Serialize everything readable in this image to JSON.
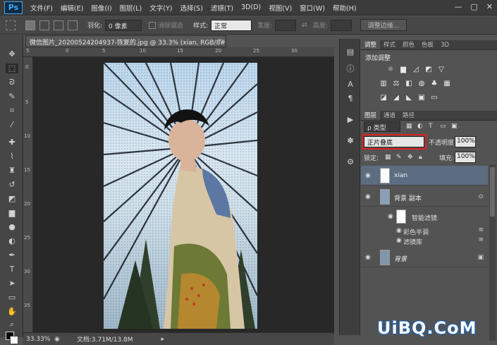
{
  "app": {
    "logo": "Ps"
  },
  "menu": [
    "文件(F)",
    "编辑(E)",
    "图像(I)",
    "图层(L)",
    "文字(Y)",
    "选择(S)",
    "滤镜(T)",
    "3D(D)",
    "视图(V)",
    "窗口(W)",
    "帮助(H)"
  ],
  "window_controls": {
    "minimize": "—",
    "restore": "▢",
    "close": "✕"
  },
  "options": {
    "feather_label": "羽化:",
    "feather_value": "0 像素",
    "antialias_label": "消除锯齿",
    "style_label": "样式:",
    "style_value": "正常",
    "width_label": "宽度:",
    "height_label": "高度:",
    "refine_edge": "调整边缘..."
  },
  "document": {
    "tab_title": "微信图片_20200524204937-恢复的.jpg @ 33.3% (xian, RGB/8#) *",
    "close": "×"
  },
  "ruler": {
    "top_ticks": [
      "5",
      "0",
      "5",
      "10",
      "15",
      "20",
      "25",
      "30"
    ],
    "left_ticks": [
      "0",
      "5",
      "10",
      "15",
      "20",
      "25",
      "30",
      "35"
    ]
  },
  "status": {
    "zoom": "33.33%",
    "doc_info": "文档:3.71M/13.8M"
  },
  "tools": [
    "move-icon",
    "marquee-icon",
    "lasso-icon",
    "quick-select-icon",
    "crop-icon",
    "eyedropper-icon",
    "healing-icon",
    "brush-icon",
    "clone-stamp-icon",
    "history-brush-icon",
    "eraser-icon",
    "gradient-icon",
    "blur-icon",
    "dodge-icon",
    "pen-icon",
    "type-icon",
    "path-select-icon",
    "shape-icon",
    "hand-icon",
    "zoom-icon"
  ],
  "adjust_panel": {
    "tabs": [
      "调整",
      "样式",
      "颜色",
      "色板",
      "3D"
    ],
    "title": "添加调整"
  },
  "layers_panel": {
    "tabs": [
      "图层",
      "通道",
      "路径"
    ],
    "filter": "ρ 类型",
    "blend_mode": "正片叠底",
    "opacity_label": "不透明度:",
    "opacity_value": "100%",
    "lock_label": "锁定:",
    "fill_label": "填充:",
    "fill_value": "100%",
    "layers": [
      {
        "name": "xian",
        "selected": true
      },
      {
        "name": "背景 副本",
        "selected": false
      },
      {
        "name": "背景",
        "selected": false
      }
    ],
    "smart_filter_label": "智能滤镜",
    "sub_filters": [
      "彩色半调",
      "滤镜库"
    ]
  },
  "watermark": "UiBQ.CoM",
  "colors": {
    "accent_blue": "#3fa7f5",
    "selection_red": "#e02020",
    "selected_layer": "#5c6d82"
  }
}
